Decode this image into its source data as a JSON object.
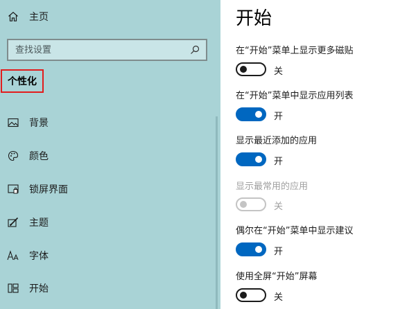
{
  "sidebar": {
    "home_label": "主页",
    "search_placeholder": "查找设置",
    "category_label": "个性化",
    "items": [
      {
        "label": "背景",
        "icon": "picture-icon"
      },
      {
        "label": "颜色",
        "icon": "palette-icon"
      },
      {
        "label": "锁屏界面",
        "icon": "lock-screen-icon"
      },
      {
        "label": "主题",
        "icon": "theme-brush-icon"
      },
      {
        "label": "字体",
        "icon": "font-icon"
      },
      {
        "label": "开始",
        "icon": "start-menu-icon"
      }
    ]
  },
  "main": {
    "title": "开始",
    "settings": [
      {
        "label": "在“开始”菜单上显示更多磁贴",
        "state": "关",
        "on": false,
        "disabled": false
      },
      {
        "label": "在“开始”菜单中显示应用列表",
        "state": "开",
        "on": true,
        "disabled": false
      },
      {
        "label": "显示最近添加的应用",
        "state": "开",
        "on": true,
        "disabled": false
      },
      {
        "label": "显示最常用的应用",
        "state": "关",
        "on": false,
        "disabled": true
      },
      {
        "label": "偶尔在“开始”菜单中显示建议",
        "state": "开",
        "on": true,
        "disabled": false
      },
      {
        "label": "使用全屏“开始”屏幕",
        "state": "关",
        "on": false,
        "disabled": false
      }
    ]
  },
  "colors": {
    "sidebar_bg": "#a9d3d6",
    "accent": "#0067c0",
    "highlight_border": "#e21c1c"
  }
}
